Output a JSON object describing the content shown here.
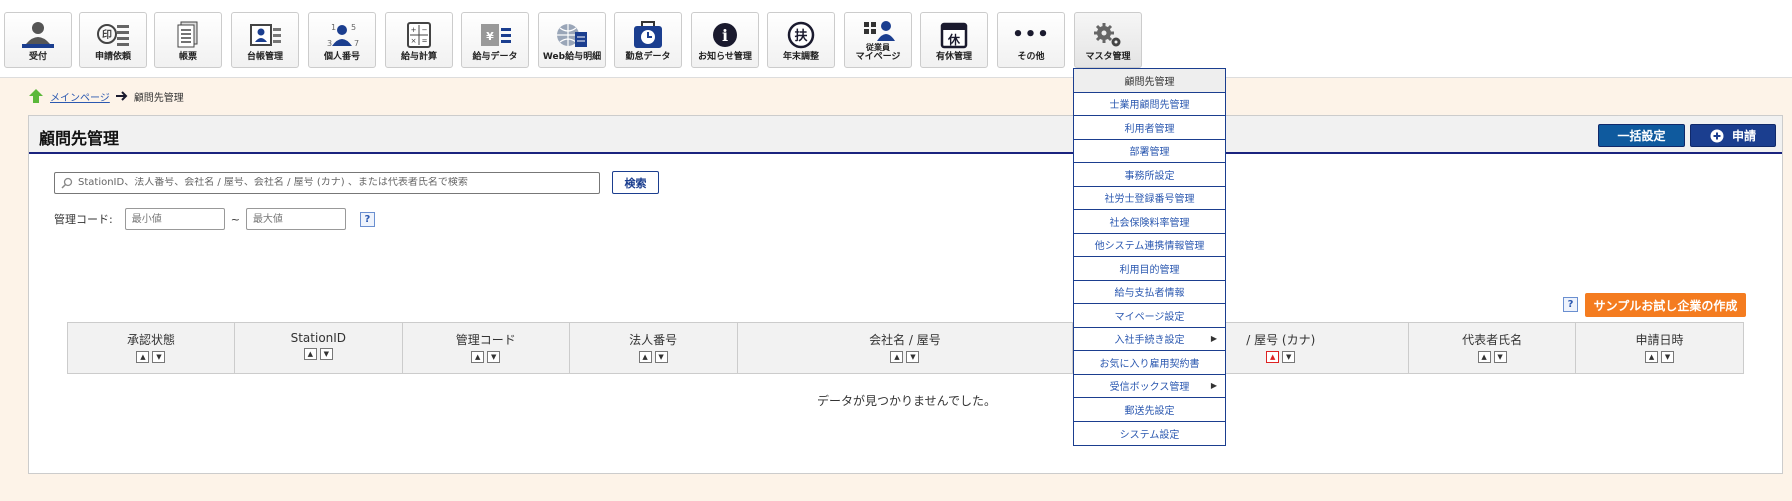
{
  "toolbar": {
    "items": [
      {
        "label": "受付",
        "icon": "reception-icon"
      },
      {
        "label": "申請依頼",
        "icon": "application-request-icon"
      },
      {
        "label": "帳票",
        "icon": "document-icon"
      },
      {
        "label": "台帳管理",
        "icon": "ledger-icon"
      },
      {
        "label": "個人番号",
        "icon": "personal-number-icon"
      },
      {
        "label": "給与計算",
        "icon": "calculator-icon"
      },
      {
        "label": "給与データ",
        "icon": "payroll-data-icon"
      },
      {
        "label": "Web給与明細",
        "icon": "web-payslip-icon"
      },
      {
        "label": "勤怠データ",
        "icon": "attendance-icon"
      },
      {
        "label": "お知らせ管理",
        "icon": "info-icon"
      },
      {
        "label": "年末調整",
        "icon": "year-end-icon"
      },
      {
        "label1": "従業員",
        "label2": "マイページ",
        "icon": "employee-mypage-icon"
      },
      {
        "label": "有休管理",
        "icon": "paid-leave-icon"
      },
      {
        "label": "その他",
        "icon": "more-icon"
      },
      {
        "label": "マスタ管理",
        "icon": "gears-icon"
      }
    ],
    "icon_glyphs": {
      "personal_digits": [
        "1",
        "5",
        "3",
        "7"
      ],
      "seal": "印",
      "leave": "休",
      "support": "扶",
      "info": "i",
      "more": "•••"
    }
  },
  "breadcrumb": {
    "home": "メインページ",
    "current": "顧問先管理"
  },
  "panel": {
    "title": "顧問先管理",
    "bulk_button": "一括設定",
    "apply_button": "申請",
    "search_placeholder": "StationID、法人番号、会社名 / 屋号、会社名 / 屋号 (カナ) 、または代表者氏名で検索",
    "search_button": "検索",
    "code_label": "管理コード:",
    "code_min_placeholder": "最小値",
    "code_sep": "~",
    "code_max_placeholder": "最大値",
    "help": "?",
    "sample_button": "サンプルお試し企業の作成",
    "no_data": "データが見つかりませんでした。"
  },
  "table": {
    "columns": [
      "承認状態",
      "StationID",
      "管理コード",
      "法人番号",
      "会社名 / 屋号",
      "/ 屋号 (カナ)",
      "代表者氏名",
      "申請日時"
    ]
  },
  "dropdown": {
    "items": [
      {
        "label": "顧問先管理",
        "submenu": false
      },
      {
        "label": "士業用顧問先管理",
        "submenu": false
      },
      {
        "label": "利用者管理",
        "submenu": false
      },
      {
        "label": "部署管理",
        "submenu": false
      },
      {
        "label": "事務所設定",
        "submenu": false
      },
      {
        "label": "社労士登録番号管理",
        "submenu": false
      },
      {
        "label": "社会保険料率管理",
        "submenu": false
      },
      {
        "label": "他システム連携情報管理",
        "submenu": false
      },
      {
        "label": "利用目的管理",
        "submenu": false
      },
      {
        "label": "給与支払者情報",
        "submenu": false
      },
      {
        "label": "マイページ設定",
        "submenu": false
      },
      {
        "label": "入社手続き設定",
        "submenu": true
      },
      {
        "label": "お気に入り雇用契約書",
        "submenu": false
      },
      {
        "label": "受信ボックス管理",
        "submenu": true
      },
      {
        "label": "郵送先設定",
        "submenu": false
      },
      {
        "label": "システム設定",
        "submenu": false
      }
    ]
  },
  "colors": {
    "navy": "#1b3e8f",
    "orange": "#f47c20",
    "link": "#2b58b0",
    "bg": "#fdf3e8"
  }
}
